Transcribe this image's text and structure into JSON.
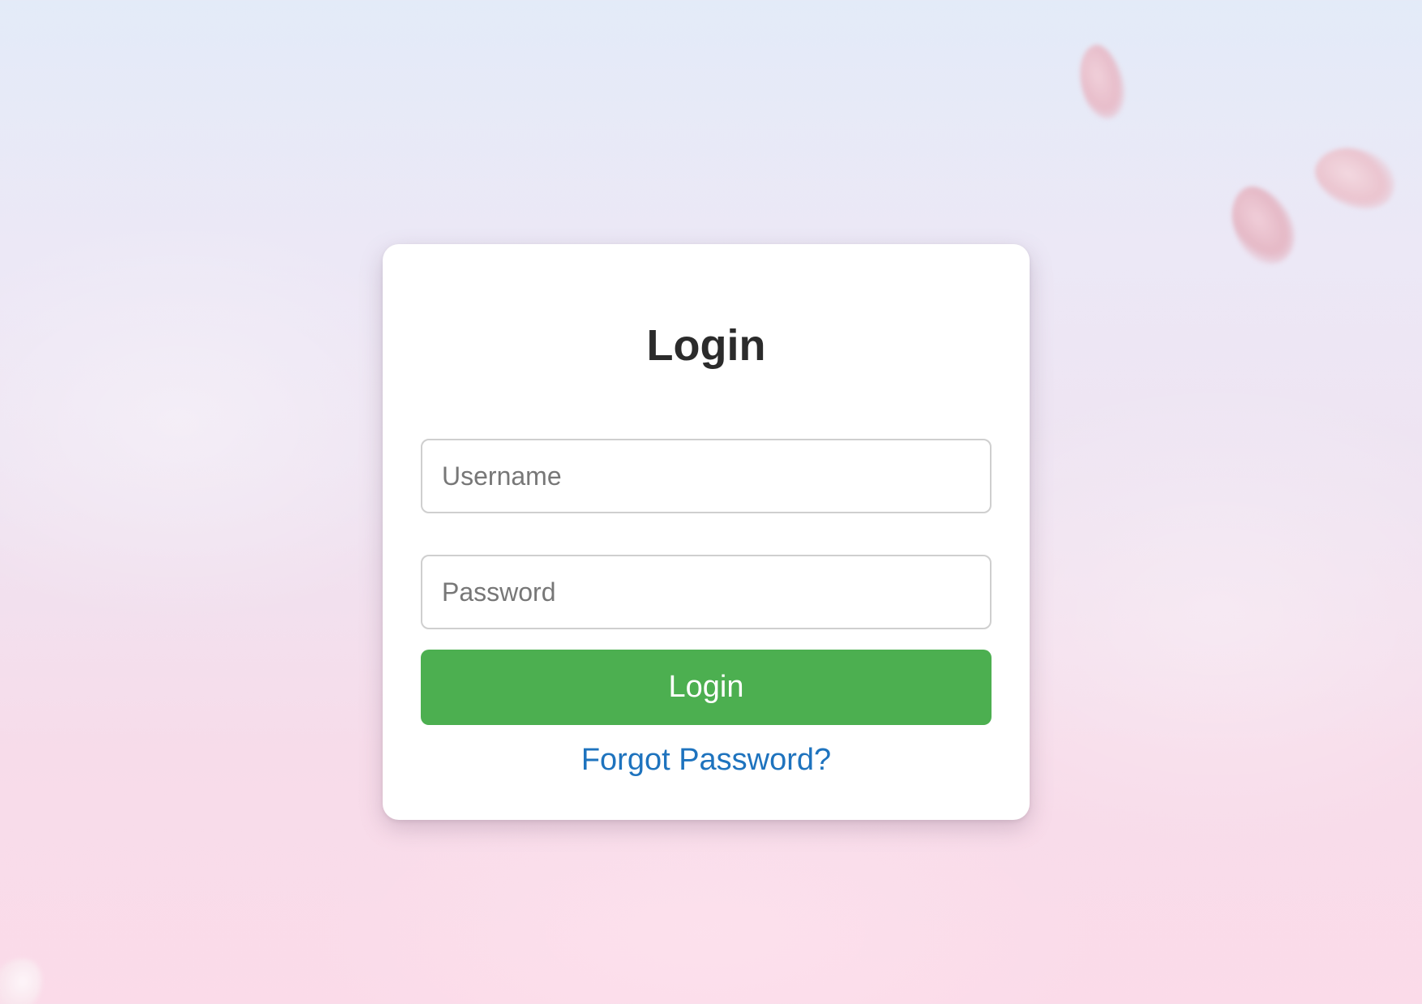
{
  "login": {
    "title": "Login",
    "username_placeholder": "Username",
    "password_placeholder": "Password",
    "submit_label": "Login",
    "forgot_link": "Forgot Password?"
  },
  "colors": {
    "primary_button": "#4caf50",
    "link": "#1e73be",
    "card_background": "#ffffff"
  },
  "decorations": {
    "background_icon": "cherry-blossom-petals-icon"
  }
}
